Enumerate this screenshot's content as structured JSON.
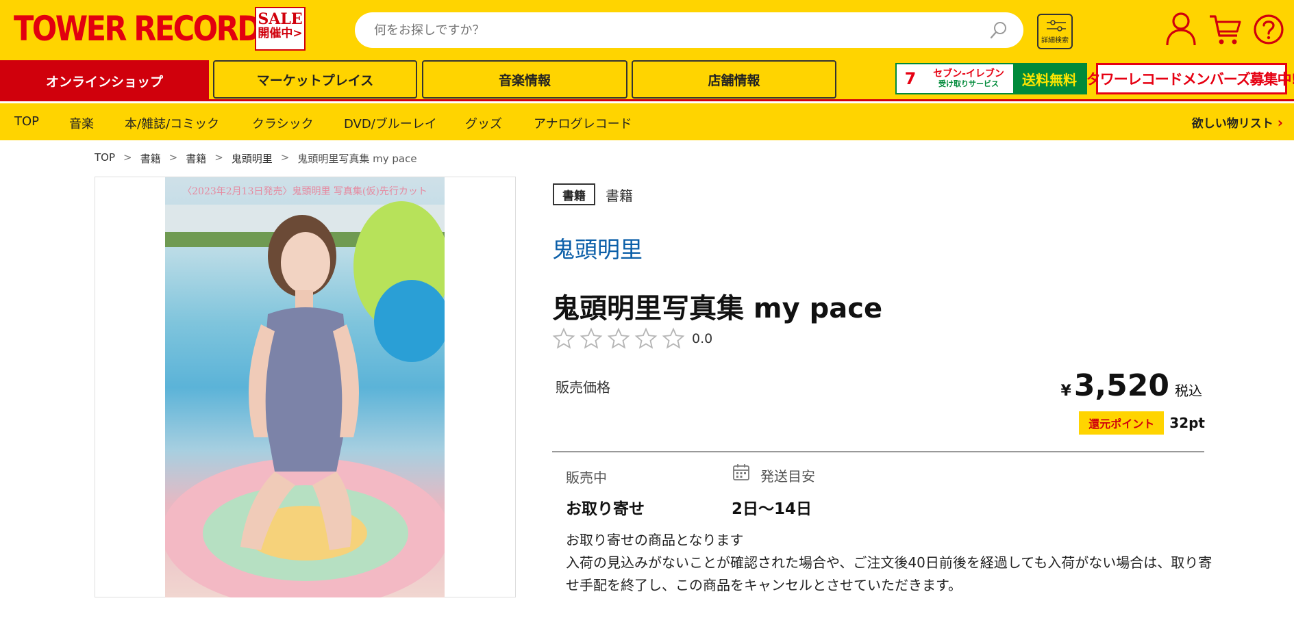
{
  "header": {
    "logo": "TOWER RECORDS",
    "sale_line1": "SALE",
    "sale_line2": "開催中>",
    "search_placeholder": "何をお探しですか？",
    "advanced_search_label": "詳細検索",
    "icons": [
      "user-icon",
      "cart-icon",
      "help-icon",
      "search-icon"
    ]
  },
  "tabs": [
    {
      "label": "オンラインショップ",
      "active": true
    },
    {
      "label": "マーケットプレイス",
      "active": false
    },
    {
      "label": "音楽情報",
      "active": false
    },
    {
      "label": "店舗情報",
      "active": false
    }
  ],
  "banners": {
    "seven_logo": "7",
    "seven_line1": "セブン-イレブン",
    "seven_line2": "受け取りサービス",
    "seven_free": "送料無料",
    "members": "タワーレコードメンバーズ募集中!"
  },
  "category_nav": {
    "items": [
      "TOP",
      "音楽",
      "本/雑誌/コミック",
      "クラシック",
      "DVD/ブルーレイ",
      "グッズ",
      "アナログレコード"
    ],
    "wishlist": "欲しい物リスト"
  },
  "breadcrumb": [
    "TOP",
    "書籍",
    "書籍",
    "鬼頭明里",
    "鬼頭明里写真集 my pace"
  ],
  "product": {
    "image_caption": "〈2023年2月13日発売〉鬼頭明里 写真集(仮)先行カット",
    "category_tag": "書籍",
    "category_text": "書籍",
    "artist": "鬼頭明里",
    "title": "鬼頭明里写真集 my pace",
    "rating": "0.0",
    "stars": 0,
    "price_label": "販売価格",
    "price_currency": "¥",
    "price": "3,520",
    "tax_label": "税込",
    "points_label": "還元ポイント",
    "points_value": "32pt",
    "status_label": "販売中",
    "status_value": "お取り寄せ",
    "shipping_label": "発送目安",
    "shipping_value": "2日〜14日",
    "note_line1": "お取り寄せの商品となります",
    "note_line2": "入荷の見込みがないことが確認された場合や、ご注文後40日前後を経過しても入荷がない場合は、取り寄せ手配を終了し、この商品をキャンセルとさせていただきます。"
  },
  "colors": {
    "brand_yellow": "#ffd400",
    "brand_red": "#d0000c",
    "artist_link": "#0a5ea8"
  }
}
